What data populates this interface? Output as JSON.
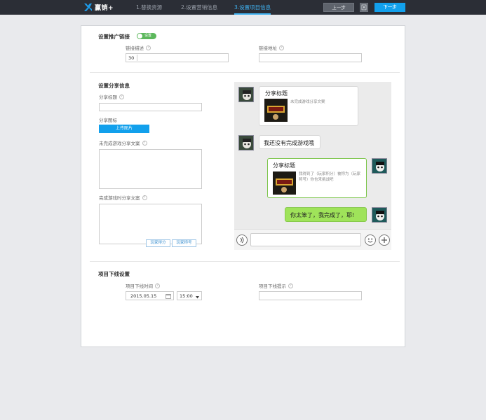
{
  "app": {
    "brand": "赢销+"
  },
  "steps": [
    {
      "label": "1.替换资源"
    },
    {
      "label": "2.设置营销信息"
    },
    {
      "label": "3.设置项目信息"
    }
  ],
  "toolbar": {
    "prev_label": "上一步",
    "next_label": "下一步"
  },
  "promo": {
    "title": "设置推广链接",
    "toggle_label": "设置",
    "desc_label": "链接描述",
    "desc_count": "30",
    "url_label": "链接地址"
  },
  "share": {
    "title": "设置分享信息",
    "title_label": "分享标题",
    "icon_label": "分享图标",
    "upload_label": "上传图片",
    "unfinished_label": "未完成游戏分享文案",
    "finished_label": "完成游戏时分享文案",
    "tag_score": "玩家得分",
    "tag_title": "玩家称号"
  },
  "preview": {
    "msg1_title": "分享标题",
    "msg1_desc": "未完成游戏分享文案",
    "msg2_text": "我还没有完成游戏哦",
    "msg3_title": "分享标题",
    "msg3_desc": "我得到了（玩家积分）被称为（玩家称号）你也来挑战吧",
    "msg4_text": "你太笨了，我完成了，耶!"
  },
  "offline": {
    "title": "项目下线设置",
    "time_label": "项目下线时间",
    "date_value": "2015.05.15",
    "time_value": "15:00",
    "notice_label": "项目下线提示"
  },
  "icons": {
    "logo": "x-logo-icon",
    "calendar": "calendar-icon",
    "dropdown": "chevron-down-icon",
    "voice": "voice-icon",
    "emoji": "emoji-icon",
    "plus": "plus-icon",
    "help": "question-icon"
  },
  "colors": {
    "accent": "#12a0ec",
    "toggle": "#5cb85c",
    "bubble_green": "#9fe35a",
    "topbar": "#2b2e36"
  }
}
